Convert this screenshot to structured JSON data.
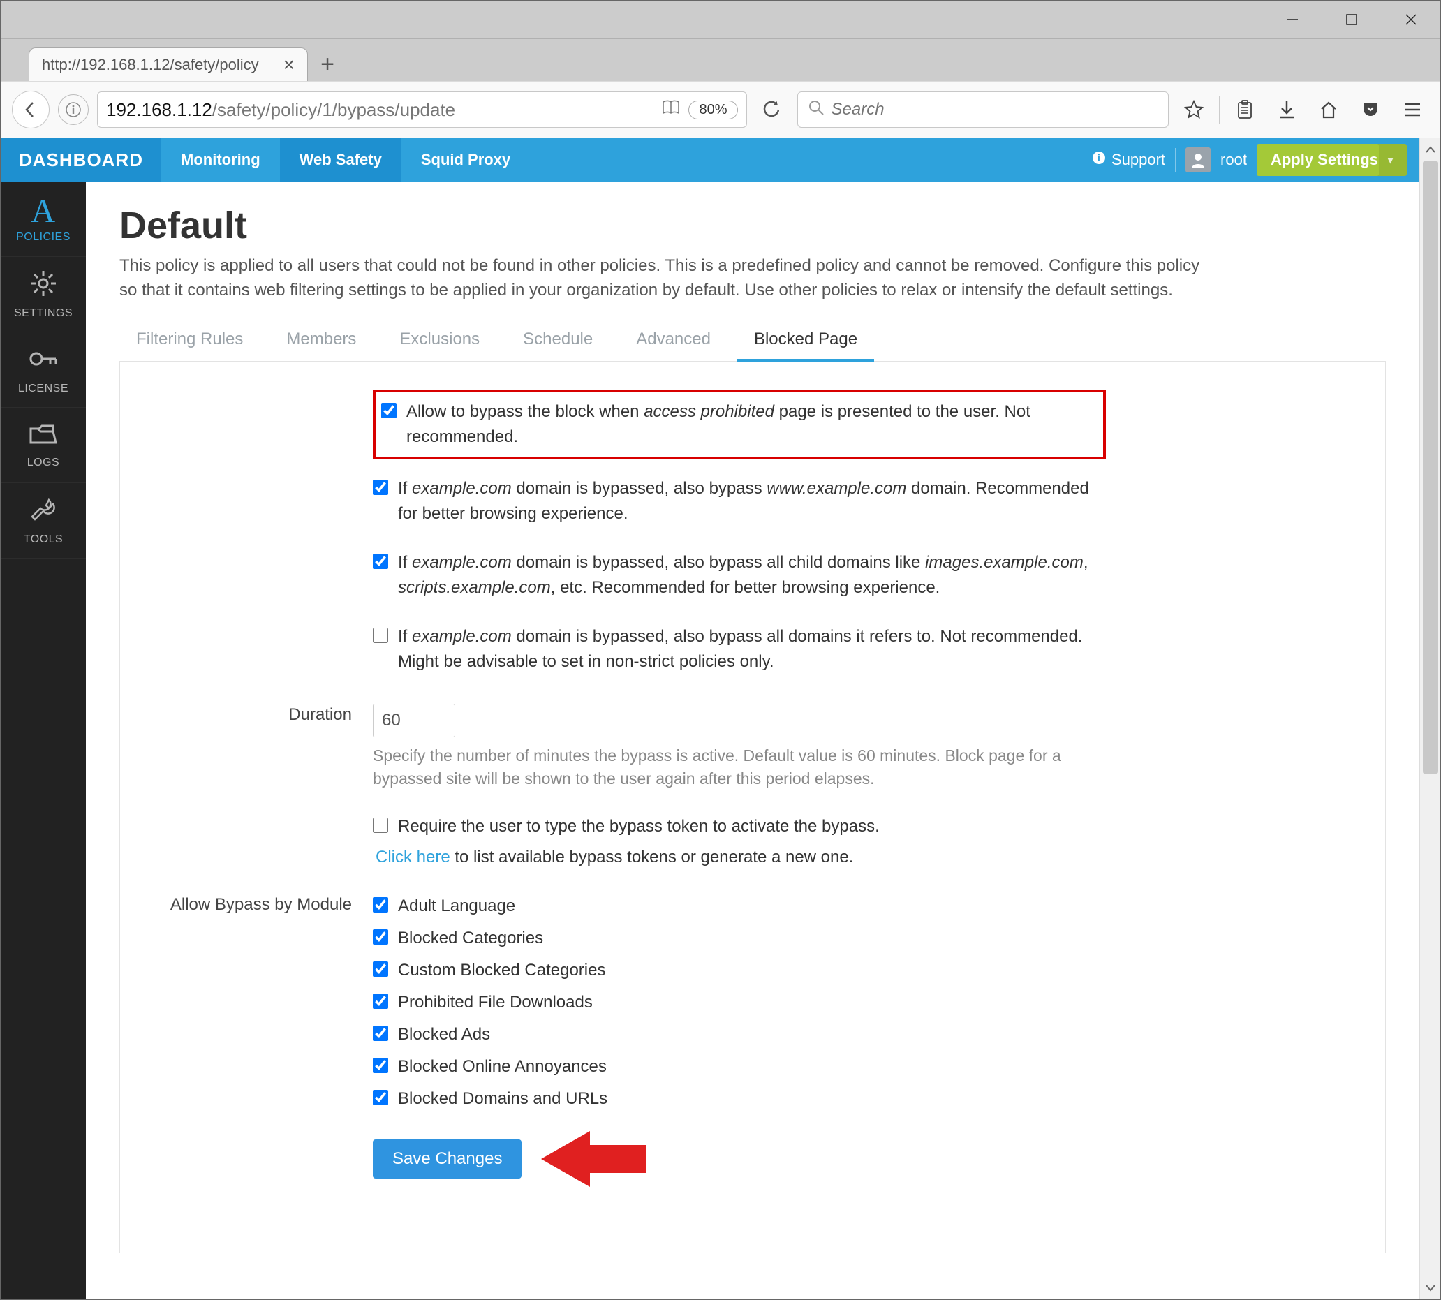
{
  "browser": {
    "tab_title": "http://192.168.1.12/safety/policy",
    "url_display_host": "192.168.1.12",
    "url_display_path": "/safety/policy/1/bypass/update",
    "zoom": "80%",
    "search_placeholder": "Search"
  },
  "header": {
    "brand": "DASHBOARD",
    "nav": {
      "monitoring": "Monitoring",
      "websafety": "Web Safety",
      "squid": "Squid Proxy"
    },
    "support": "Support",
    "user": "root",
    "apply": "Apply Settings"
  },
  "sidebar": {
    "policies": "POLICIES",
    "settings": "SETTINGS",
    "license": "LICENSE",
    "logs": "LOGS",
    "tools": "TOOLS"
  },
  "page": {
    "title": "Default",
    "desc": "This policy is applied to all users that could not be found in other policies. This is a predefined policy and cannot be removed. Configure this policy so that it contains web filtering settings to be applied in your organization by default. Use other policies to relax or intensify the default settings.",
    "tabs": {
      "filtering": "Filtering Rules",
      "members": "Members",
      "exclusions": "Exclusions",
      "schedule": "Schedule",
      "advanced": "Advanced",
      "blocked": "Blocked Page"
    }
  },
  "form": {
    "opt1_a": "Allow to bypass the block when ",
    "opt1_em": "access prohibited",
    "opt1_b": " page is presented to the user. Not recommended.",
    "opt2_a": "If ",
    "opt2_em1": "example.com",
    "opt2_b": " domain is bypassed, also bypass ",
    "opt2_em2": "www.example.com",
    "opt2_c": " domain. Recommended for better browsing experience.",
    "opt3_a": "If ",
    "opt3_em1": "example.com",
    "opt3_b": " domain is bypassed, also bypass all child domains like ",
    "opt3_em2": "images.example.com",
    "opt3_c": ", ",
    "opt3_em3": "scripts.example.com",
    "opt3_d": ", etc. Recommended for better browsing experience.",
    "opt4_a": "If ",
    "opt4_em1": "example.com",
    "opt4_b": " domain is bypassed, also bypass all domains it refers to. Not recommended. Might be advisable to set in non-strict policies only.",
    "duration_label": "Duration",
    "duration_value": "60",
    "duration_help": "Specify the number of minutes the bypass is active. Default value is 60 minutes. Block page for a bypassed site will be shown to the user again after this period elapses.",
    "opt5": "Require the user to type the bypass token to activate the bypass.",
    "token_link": "Click here",
    "token_rest": " to list available bypass tokens or generate a new one.",
    "module_label": "Allow Bypass by Module",
    "modules": {
      "m1": "Adult Language",
      "m2": "Blocked Categories",
      "m3": "Custom Blocked Categories",
      "m4": "Prohibited File Downloads",
      "m5": "Blocked Ads",
      "m6": "Blocked Online Annoyances",
      "m7": "Blocked Domains and URLs"
    },
    "save": "Save Changes"
  }
}
